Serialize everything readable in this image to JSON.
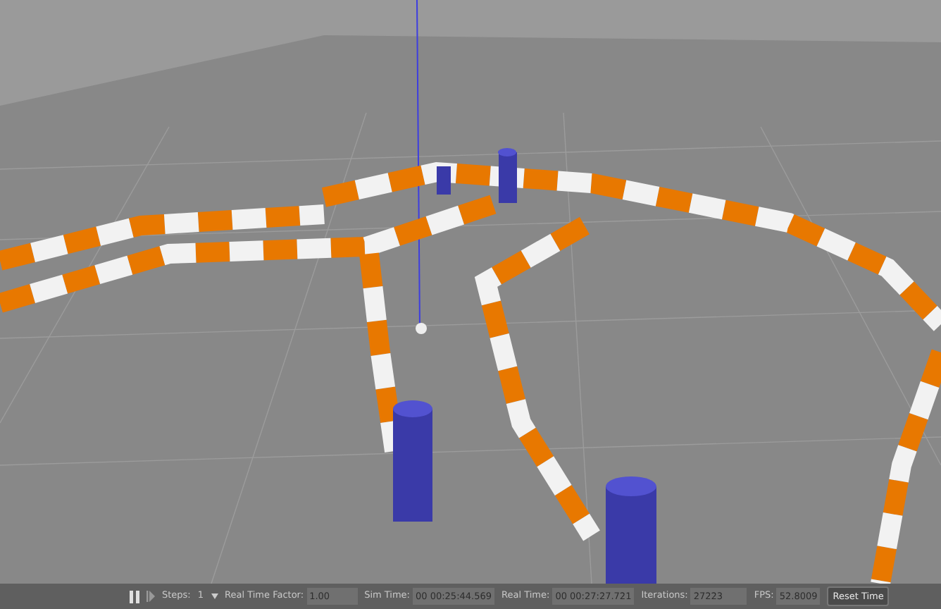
{
  "toolbar": {
    "running": true,
    "steps": {
      "label": "Steps:",
      "value": "1"
    },
    "fields": [
      {
        "label": "Real Time Factor:",
        "value": "1.00"
      },
      {
        "label": "Sim Time:",
        "value": "00 00:25:44.569"
      },
      {
        "label": "Real Time:",
        "value": "00 00:27:27.721"
      },
      {
        "label": "Iterations:",
        "value": "27223"
      },
      {
        "label": "FPS:",
        "value": "52.8009"
      }
    ],
    "reset_button": "Reset Time"
  }
}
